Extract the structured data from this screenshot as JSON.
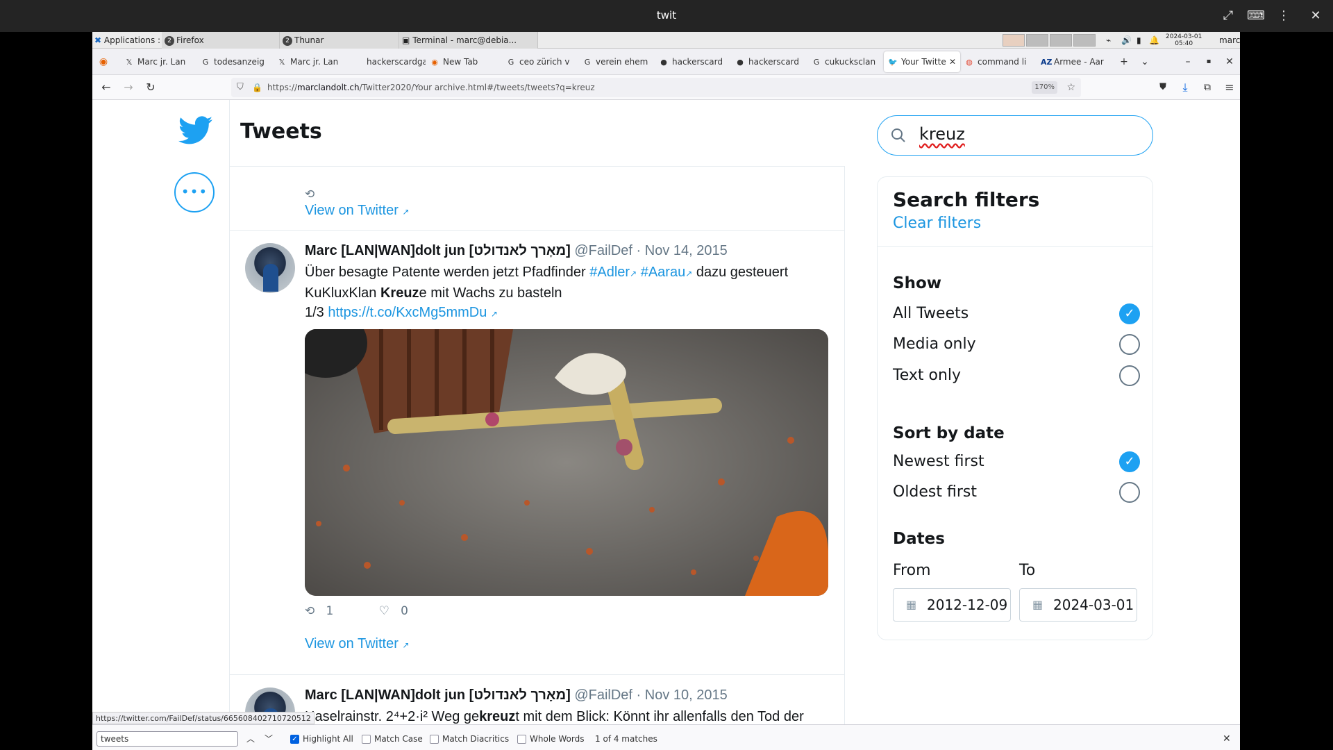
{
  "window": {
    "title": "twit"
  },
  "panel": {
    "applications": "Applications :",
    "tasks": [
      {
        "label": "Firefox",
        "badge": "2"
      },
      {
        "label": "Thunar",
        "badge": "2"
      },
      {
        "label": "Terminal - marc@debia..."
      }
    ],
    "date": "2024-03-01",
    "time": "05:40",
    "user": "marc"
  },
  "tabs": [
    {
      "label": "Marc jr. Lan"
    },
    {
      "label": "todesanzeig"
    },
    {
      "label": "Marc jr. Lan"
    },
    {
      "label": "hackerscardga"
    },
    {
      "label": "New Tab"
    },
    {
      "label": "ceo zürich v"
    },
    {
      "label": "verein ehem"
    },
    {
      "label": "hackerscard"
    },
    {
      "label": "hackerscard"
    },
    {
      "label": "cukucksclan"
    },
    {
      "label": "Your Twitte"
    },
    {
      "label": "command li"
    },
    {
      "label": "Armee - Aar"
    }
  ],
  "nav": {
    "url_prefix": "https://",
    "url_domain": "marclandolt.ch",
    "url_path": "/Twitter2020/Your archive.html#/tweets/tweets?q=kreuz",
    "zoom": "170%"
  },
  "feed": {
    "title": "Tweets",
    "prev_view_link": "View on Twitter",
    "tweets": [
      {
        "name": "Marc [LAN|WAN]dolt jun [מאָרך לאנדולט]",
        "handle": "@FailDef",
        "date": "· Nov 14, 2015",
        "t1": "Über besagte Patente werden jetzt Pfadfinder",
        "tag1": "#Adler",
        "tag2": "#Aarau",
        "t2": "dazu gesteuert",
        "t3": "KuKluxKlan",
        "hl": "Kreuz",
        "t4": "e mit Wachs zu basteln",
        "t5": "1/3",
        "link": "https://t.co/KxcMg5mmDu",
        "retweets": "1",
        "likes": "0",
        "view_link": "View on Twitter"
      },
      {
        "name": "Marc [LAN|WAN]dolt jun [מאָרך לאנדולט]",
        "handle": "@FailDef",
        "date": "· Nov 10, 2015",
        "t1": "Haselrainstr. 2⁴+2·i² Weg ge",
        "hl": "kreuz",
        "t2": "t mit dem Blick: Könnt ihr allenfalls den Tod der"
      }
    ]
  },
  "search": {
    "query": "kreuz"
  },
  "filters": {
    "title": "Search filters",
    "clear": "Clear filters",
    "show_title": "Show",
    "show": [
      {
        "label": "All Tweets",
        "checked": true
      },
      {
        "label": "Media only",
        "checked": false
      },
      {
        "label": "Text only",
        "checked": false
      }
    ],
    "sort_title": "Sort by date",
    "sort": [
      {
        "label": "Newest first",
        "checked": true
      },
      {
        "label": "Oldest first",
        "checked": false
      }
    ],
    "dates_title": "Dates",
    "from_label": "From",
    "to_label": "To",
    "from": "2012-12-09",
    "to": "2024-03-01"
  },
  "statusbar": {
    "url": "https://twitter.com/FailDef/status/665608402710720512"
  },
  "findbar": {
    "query": "tweets",
    "highlight_all": "Highlight All",
    "match_case": "Match Case",
    "match_diacritics": "Match Diacritics",
    "whole_words": "Whole Words",
    "result": "1 of 4 matches"
  }
}
